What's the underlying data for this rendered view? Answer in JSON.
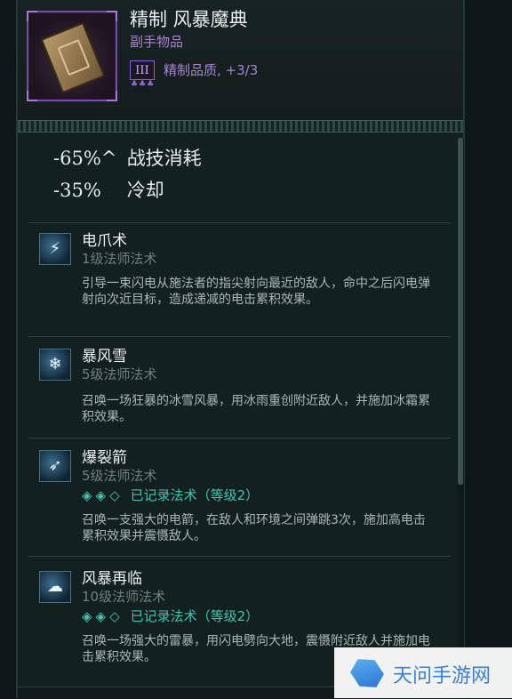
{
  "item": {
    "name": "精制 风暴魔典",
    "type": "副手物品",
    "tier_badge": "III",
    "tier_pips": "♣♣♣",
    "quality_label": "精制品质, +3/3",
    "icon": "grimoire-book-icon"
  },
  "stats": [
    {
      "value": "-65%^",
      "label": "战技消耗"
    },
    {
      "value": "-35%",
      "label": "冷却"
    }
  ],
  "skills": [
    {
      "name": "电爪术",
      "level": "1级法师法术",
      "description": "引导一束闪电从施法者的指尖射向最近的敌人，命中之后闪电弹射向次近目标，造成递减的电击累积效果。",
      "icon": "lightning-claw-icon",
      "glyph": "⚡"
    },
    {
      "name": "暴风雪",
      "level": "5级法师法术",
      "description": "召唤一场狂暴的冰雪风暴，用冰雨重创附近敌人，并施加冰霜累积效果。",
      "icon": "blizzard-icon",
      "glyph": "❄"
    },
    {
      "name": "爆裂箭",
      "level": "5级法师法术",
      "recorded_gems": "◈◈◇",
      "recorded_label": "已记录法术（等级2）",
      "description": "召唤一支强大的电箭，在敌人和环境之间弹跳3次，施加高电击累积效果并震慑敌人。",
      "icon": "bursting-arrow-icon",
      "glyph": "➶"
    },
    {
      "name": "风暴再临",
      "level": "10级法师法术",
      "recorded_gems": "◈◈◇",
      "recorded_label": "已记录法术（等级2）",
      "description": "召唤一场强大的雷暴，用闪电劈向大地，震慑附近敌人并施加电击累积效果。",
      "icon": "storm-cloud-icon",
      "glyph": "☁"
    }
  ],
  "watermark": {
    "text": "天问手游网",
    "icon": "hexagon-logo-icon"
  }
}
